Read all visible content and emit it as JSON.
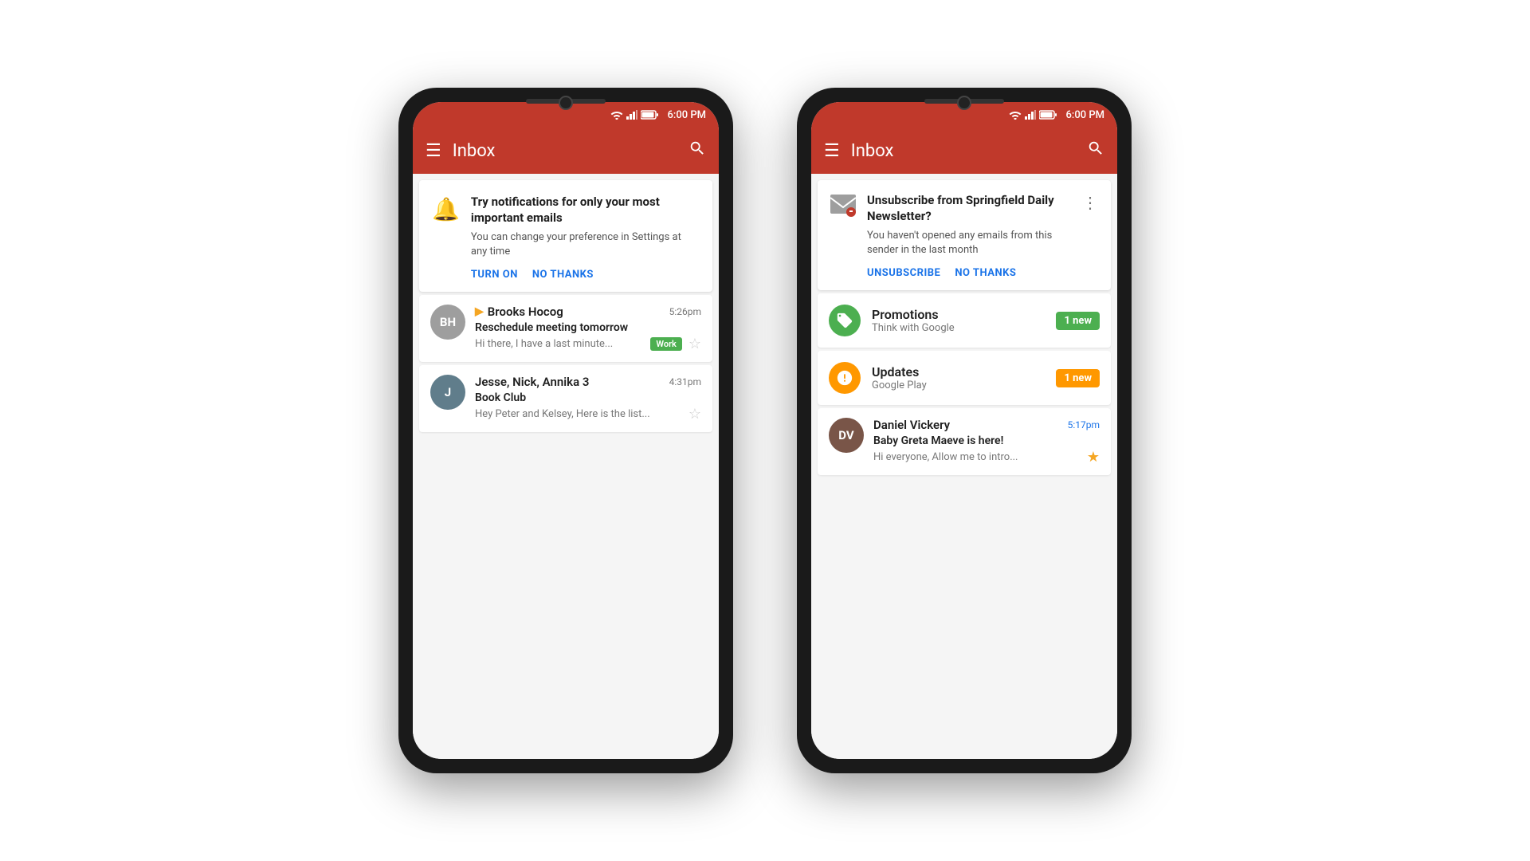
{
  "phone1": {
    "statusBar": {
      "time": "6:00 PM"
    },
    "toolbar": {
      "title": "Inbox",
      "menuLabel": "☰",
      "searchLabel": "🔍"
    },
    "notifCard": {
      "icon": "🔔",
      "title": "Try notifications for only your most important emails",
      "subtitle": "You can change your preference in Settings at any time",
      "action1": "TURN ON",
      "action2": "NO THANKS"
    },
    "emails": [
      {
        "sender": "Brooks Hocog",
        "hasPriority": true,
        "time": "5:26pm",
        "subject": "Reschedule meeting tomorrow",
        "preview": "Hi there, I have a last minute...",
        "tag": "Work",
        "starred": false,
        "avatarText": "BH",
        "avatarColor": "#9e9e9e"
      },
      {
        "sender": "Jesse, Nick, Annika 3",
        "hasPriority": false,
        "time": "4:31pm",
        "subject": "Book Club",
        "preview": "Hey Peter and Kelsey, Here is the list...",
        "tag": "",
        "starred": false,
        "avatarText": "J",
        "avatarColor": "#607d8b"
      }
    ]
  },
  "phone2": {
    "statusBar": {
      "time": "6:00 PM"
    },
    "toolbar": {
      "title": "Inbox",
      "menuLabel": "☰",
      "searchLabel": "🔍"
    },
    "unsubCard": {
      "title": "Unsubscribe from Springfield Daily Newsletter?",
      "subtitle": "You haven't opened any emails from this sender in the last month",
      "action1": "UNSUBSCRIBE",
      "action2": "NO THANKS"
    },
    "categories": [
      {
        "name": "Promotions",
        "sub": "Think with Google",
        "badge": "1 new",
        "badgeColor": "green",
        "iconEmoji": "🏷️",
        "iconBg": "green"
      },
      {
        "name": "Updates",
        "sub": "Google Play",
        "badge": "1 new",
        "badgeColor": "orange",
        "iconEmoji": "ℹ️",
        "iconBg": "orange"
      }
    ],
    "email": {
      "sender": "Daniel Vickery",
      "time": "5:17pm",
      "subject": "Baby Greta Maeve is here!",
      "preview": "Hi everyone, Allow me to intro...",
      "starred": true,
      "avatarText": "DV",
      "avatarColor": "#795548"
    }
  }
}
